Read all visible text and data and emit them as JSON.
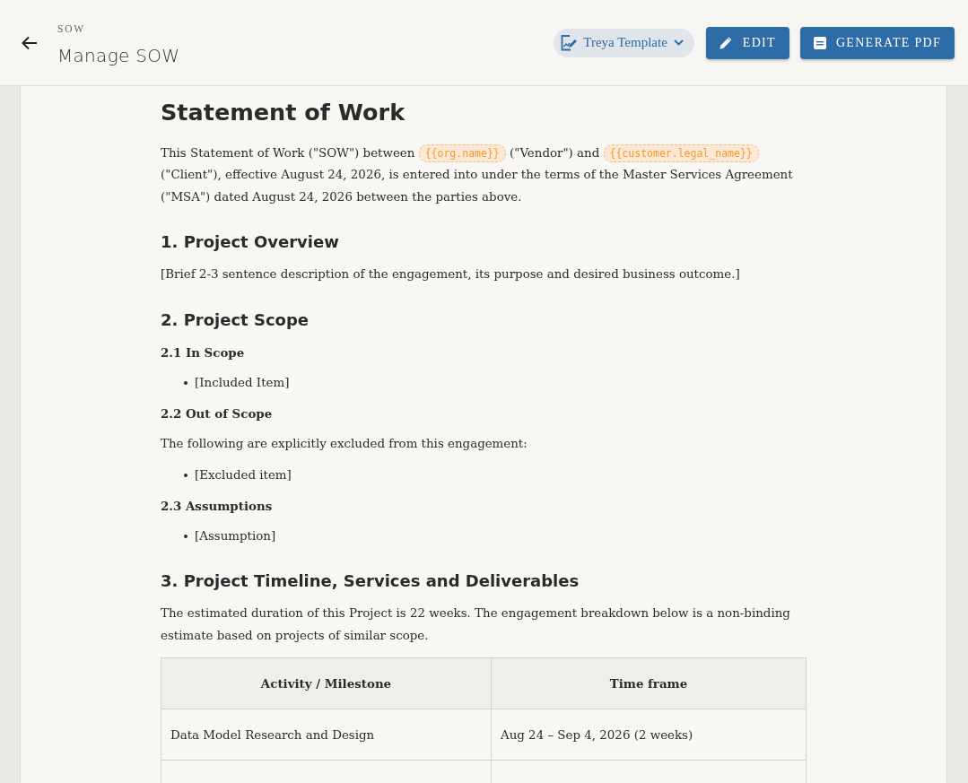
{
  "header": {
    "breadcrumb": "SOW",
    "title": "Manage SOW",
    "template": {
      "label": "Treya Template"
    },
    "buttons": [
      {
        "kind": "edit",
        "label": "EDIT"
      },
      {
        "kind": "pdf",
        "label": "GENERATE PDF"
      }
    ]
  },
  "document": {
    "title": "Statement of Work",
    "blocks": [
      {
        "kind": "paragraph",
        "segments": [
          {
            "kind": "text",
            "text": "This Statement of Work (\"SOW\") between "
          },
          {
            "kind": "variable",
            "text": "{{org.name}}"
          },
          {
            "kind": "text",
            "text": " (\"Vendor\") and "
          },
          {
            "kind": "variable",
            "text": "{{customer.legal_name}}"
          },
          {
            "kind": "text",
            "text": " (\"Client\"), effective August 24, 2026, is entered into under the terms of the Master Services Agreement (\"MSA\") dated August 24, 2026 between the parties above."
          }
        ]
      },
      {
        "kind": "heading",
        "text": "1. Project Overview"
      },
      {
        "kind": "paragraph",
        "segments": [
          {
            "kind": "text",
            "text": "[Brief 2-3 sentence description of the engagement, its purpose and desired business outcome.]"
          }
        ]
      },
      {
        "kind": "heading",
        "text": "2. Project Scope"
      },
      {
        "kind": "subheading",
        "text": "2.1 In Scope"
      },
      {
        "kind": "bullets",
        "items": [
          "[Included Item]"
        ]
      },
      {
        "kind": "subheading",
        "text": "2.2 Out of Scope"
      },
      {
        "kind": "paragraph",
        "segments": [
          {
            "kind": "text",
            "text": "The following are explicitly excluded from this engagement:"
          }
        ]
      },
      {
        "kind": "bullets",
        "items": [
          "[Excluded item]"
        ]
      },
      {
        "kind": "subheading",
        "text": "2.3 Assumptions"
      },
      {
        "kind": "bullets",
        "items": [
          "[Assumption]"
        ]
      },
      {
        "kind": "heading",
        "text": "3. Project Timeline, Services and Deliverables"
      },
      {
        "kind": "paragraph",
        "segments": [
          {
            "kind": "text",
            "text": "The estimated duration of this Project is 22 weeks. The engagement breakdown below is a non-binding estimate based on projects of similar scope."
          }
        ]
      },
      {
        "kind": "table",
        "columns": [
          "Activity / Milestone",
          "Time frame"
        ],
        "rows": [
          [
            "Data Model Research and Design",
            "Aug 24 – Sep 4, 2026 (2 weeks)"
          ]
        ]
      }
    ]
  }
}
